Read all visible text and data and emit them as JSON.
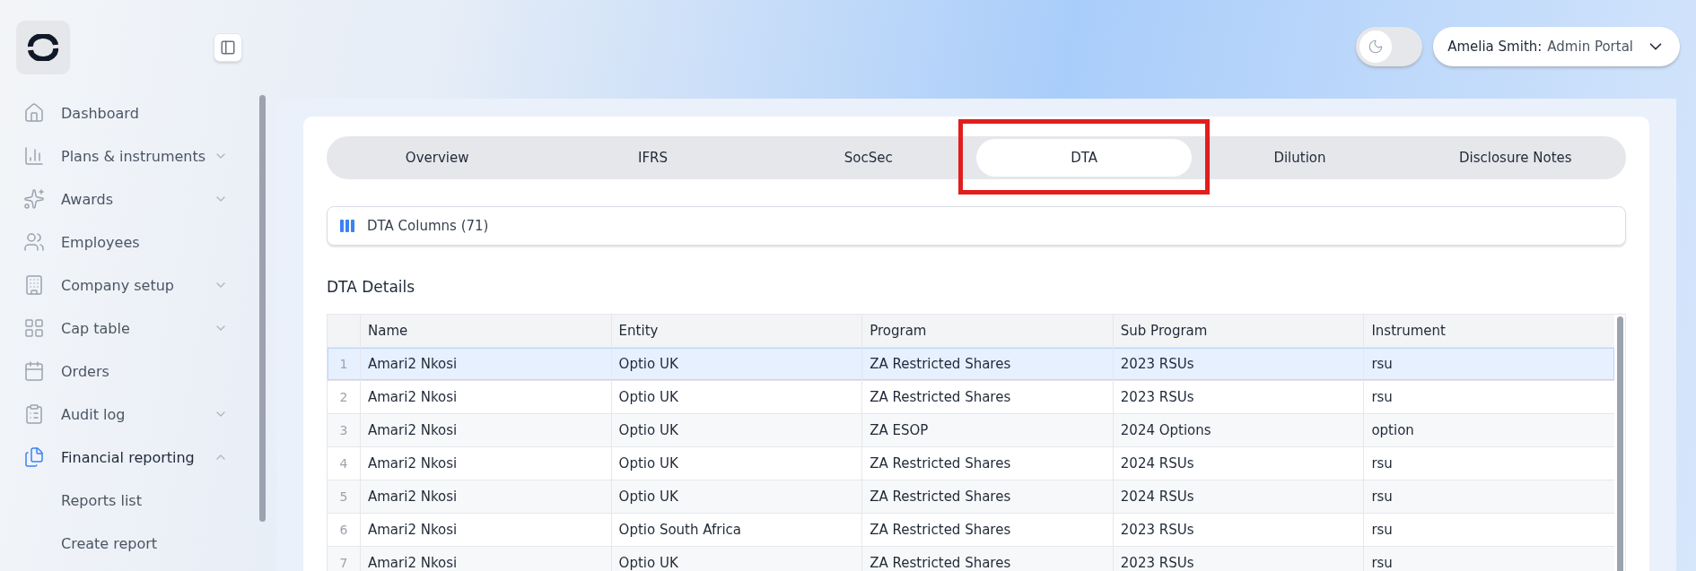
{
  "sidebar": {
    "items": [
      {
        "label": "Dashboard",
        "selected": false
      },
      {
        "label": "Plans & instruments",
        "selected": false,
        "expanded": false
      },
      {
        "label": "Awards",
        "selected": false,
        "expanded": false
      },
      {
        "label": "Employees",
        "selected": false
      },
      {
        "label": "Company setup",
        "selected": false,
        "expanded": false
      },
      {
        "label": "Cap table",
        "selected": false,
        "expanded": false
      },
      {
        "label": "Orders",
        "selected": false
      },
      {
        "label": "Audit log",
        "selected": false,
        "expanded": false
      },
      {
        "label": "Financial reporting",
        "selected": true,
        "expanded": true,
        "children": [
          {
            "label": "Reports list",
            "selected": false
          },
          {
            "label": "Create report",
            "selected": false
          }
        ]
      }
    ]
  },
  "header": {
    "dark_mode": false,
    "user": {
      "name": "Amelia Smith:",
      "portal": "Admin Portal"
    }
  },
  "tabs": [
    {
      "label": "Overview",
      "selected": false,
      "highlighted": false
    },
    {
      "label": "IFRS",
      "selected": false,
      "highlighted": false
    },
    {
      "label": "SocSec",
      "selected": false,
      "highlighted": false
    },
    {
      "label": "DTA",
      "selected": true,
      "highlighted": true
    },
    {
      "label": "Dilution",
      "selected": false,
      "highlighted": false
    },
    {
      "label": "Disclosure Notes",
      "selected": false,
      "highlighted": false
    }
  ],
  "columns_button": {
    "label": "DTA Columns",
    "count": "(71)"
  },
  "section_title": "DTA Details",
  "table": {
    "columns": [
      "Name",
      "Entity",
      "Program",
      "Sub Program",
      "Instrument"
    ],
    "rows": [
      {
        "index": "1",
        "selected": true,
        "cells": [
          "Amari2 Nkosi",
          "Optio UK",
          "ZA Restricted Shares",
          "2023 RSUs",
          "rsu"
        ]
      },
      {
        "index": "2",
        "selected": false,
        "cells": [
          "Amari2 Nkosi",
          "Optio UK",
          "ZA Restricted Shares",
          "2023 RSUs",
          "rsu"
        ]
      },
      {
        "index": "3",
        "selected": false,
        "cells": [
          "Amari2 Nkosi",
          "Optio UK",
          "ZA ESOP",
          "2024 Options",
          "option"
        ]
      },
      {
        "index": "4",
        "selected": false,
        "cells": [
          "Amari2 Nkosi",
          "Optio UK",
          "ZA Restricted Shares",
          "2024 RSUs",
          "rsu"
        ]
      },
      {
        "index": "5",
        "selected": false,
        "cells": [
          "Amari2 Nkosi",
          "Optio UK",
          "ZA Restricted Shares",
          "2024 RSUs",
          "rsu"
        ]
      },
      {
        "index": "6",
        "selected": false,
        "cells": [
          "Amari2 Nkosi",
          "Optio South Africa",
          "ZA Restricted Shares",
          "2023 RSUs",
          "rsu"
        ]
      },
      {
        "index": "7",
        "selected": false,
        "cells": [
          "Amari2 Nkosi",
          "Optio UK",
          "ZA Restricted Shares",
          "2023 RSUs",
          "rsu"
        ]
      }
    ]
  }
}
